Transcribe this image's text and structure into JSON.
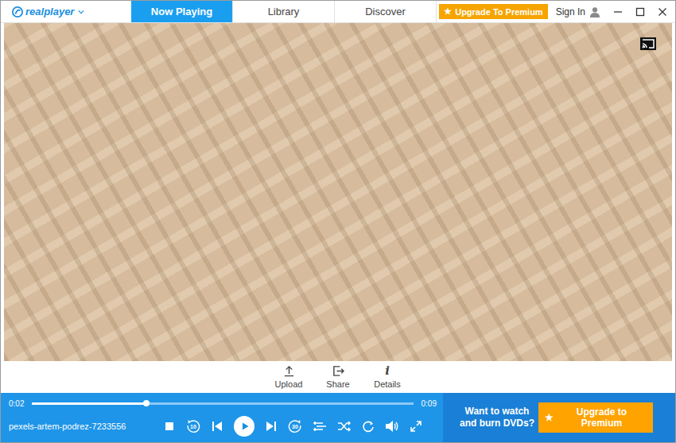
{
  "app": {
    "logo": "realplayer"
  },
  "tabs": [
    {
      "label": "Now Playing",
      "selected": true
    },
    {
      "label": "Library",
      "selected": false
    },
    {
      "label": "Discover",
      "selected": false
    }
  ],
  "header": {
    "upgrade_star": "★",
    "upgrade_button": "Upgrade To Premium",
    "sign_in": "Sign In"
  },
  "actions": [
    {
      "label": "Upload",
      "kind": "upload"
    },
    {
      "label": "Share",
      "kind": "share"
    },
    {
      "label": "Details",
      "kind": "details",
      "glyph": "i"
    }
  ],
  "player": {
    "elapsed": "0:02",
    "duration": "0:09",
    "level": 0.3,
    "title": "pexels-artem-podrez-7233556",
    "playing": false,
    "skip_back": "10",
    "skip_forward": "30"
  },
  "promo": {
    "text": "Want to watch and burn DVDs?",
    "star": "★",
    "button": "Upgrade to Premium"
  }
}
